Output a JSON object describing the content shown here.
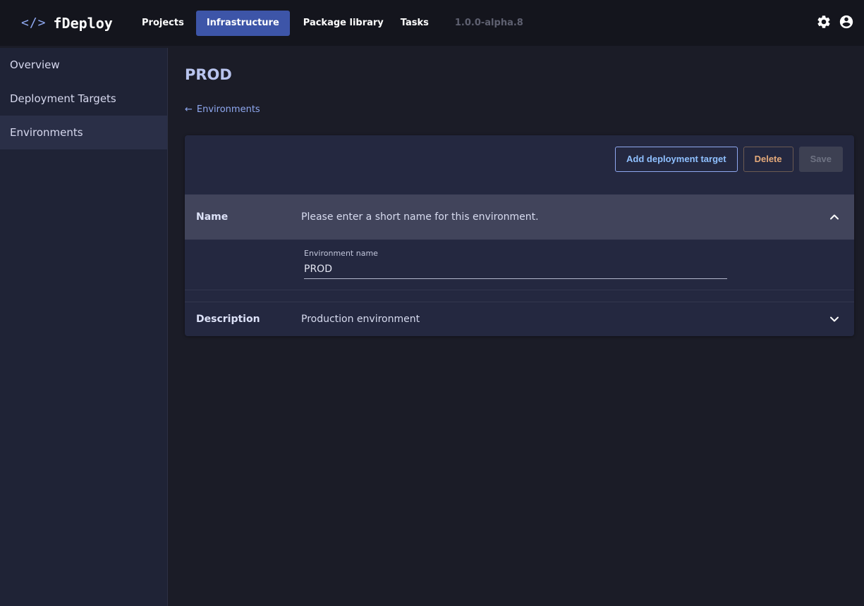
{
  "brand": {
    "icon_text": "</>",
    "name": "fDeploy"
  },
  "nav": {
    "items": [
      {
        "label": "Projects"
      },
      {
        "label": "Infrastructure",
        "active": true
      },
      {
        "label": "Package library"
      },
      {
        "label": "Tasks"
      }
    ],
    "version": "1.0.0-alpha.8"
  },
  "top_icons": [
    "gear-icon",
    "account-circle-icon"
  ],
  "sidebar": {
    "items": [
      {
        "label": "Overview"
      },
      {
        "label": "Deployment Targets"
      },
      {
        "label": "Environments",
        "active": true
      }
    ]
  },
  "page": {
    "title": "PROD",
    "back_label": "Environments"
  },
  "toolbar": {
    "add_label": "Add deployment target",
    "delete_label": "Delete",
    "save_label": "Save"
  },
  "sections": {
    "name": {
      "label": "Name",
      "summary": "Please enter a short name for this environment.",
      "field_label": "Environment name",
      "field_value": "PROD"
    },
    "description": {
      "label": "Description",
      "summary": "Production environment"
    }
  },
  "colors": {
    "accent": "#3d55a8",
    "link": "#8fa8f0",
    "delete": "#e3a97a",
    "background": "#1b1c27",
    "topbar": "#14151d",
    "sidebar": "#1f2336"
  }
}
